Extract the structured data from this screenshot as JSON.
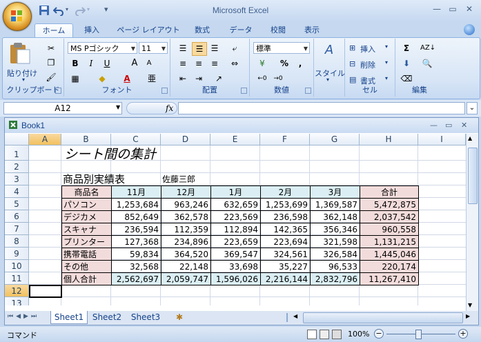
{
  "window": {
    "title": "Microsoft Excel"
  },
  "ribbon": {
    "tabs": [
      "ホーム",
      "挿入",
      "ページ レイアウト",
      "数式",
      "データ",
      "校閲",
      "表示"
    ],
    "active_tab": "ホーム",
    "clipboard": {
      "paste_label": "貼り付け",
      "group_label": "クリップボード"
    },
    "font": {
      "name": "MS Pゴシック",
      "size": "11",
      "bold": "B",
      "italic": "I",
      "underline": "U",
      "grow": "A",
      "shrink": "A",
      "phonetic": "亜",
      "group_label": "フォント"
    },
    "alignment": {
      "group_label": "配置"
    },
    "number": {
      "format": "標準",
      "percent": "%",
      "comma": ",",
      "group_label": "数値"
    },
    "styles": {
      "label": "スタイル"
    },
    "cells": {
      "insert": "挿入",
      "delete": "削除",
      "format": "書式",
      "group_label": "セル"
    },
    "editing": {
      "group_label": "編集"
    }
  },
  "formula_bar": {
    "name_box": "A12",
    "fx": "fx",
    "formula": ""
  },
  "workbook": {
    "title": "Book1",
    "columns": [
      "A",
      "B",
      "C",
      "D",
      "E",
      "F",
      "G",
      "H",
      "I"
    ],
    "rows": [
      "1",
      "2",
      "3",
      "4",
      "5",
      "6",
      "7",
      "8",
      "9",
      "10",
      "11",
      "12",
      "13"
    ],
    "cells": {
      "title": "シート間の集計",
      "subtitle": "商品別実績表",
      "author": "佐藤三郎"
    },
    "table": {
      "headers": [
        "商品名",
        "11月",
        "12月",
        "1月",
        "2月",
        "3月",
        "合計"
      ],
      "rows": [
        [
          "パソコン",
          "1,253,684",
          "963,246",
          "632,659",
          "1,253,699",
          "1,369,587",
          "5,472,875"
        ],
        [
          "デジカメ",
          "852,649",
          "362,578",
          "223,569",
          "236,598",
          "362,148",
          "2,037,542"
        ],
        [
          "スキャナ",
          "236,594",
          "112,359",
          "112,894",
          "142,365",
          "356,346",
          "960,558"
        ],
        [
          "プリンター",
          "127,368",
          "234,896",
          "223,659",
          "223,694",
          "321,598",
          "1,131,215"
        ],
        [
          "携帯電話",
          "59,834",
          "364,520",
          "369,547",
          "324,561",
          "326,584",
          "1,445,046"
        ],
        [
          "その他",
          "32,568",
          "22,148",
          "33,698",
          "35,227",
          "96,533",
          "220,174"
        ],
        [
          "個人合計",
          "2,562,697",
          "2,059,747",
          "1,596,026",
          "2,216,144",
          "2,832,796",
          "11,267,410"
        ]
      ]
    },
    "sheets": [
      "Sheet1",
      "Sheet2",
      "Sheet3"
    ],
    "active_sheet": "Sheet1"
  },
  "status_bar": {
    "mode": "コマンド",
    "zoom": "100%"
  }
}
